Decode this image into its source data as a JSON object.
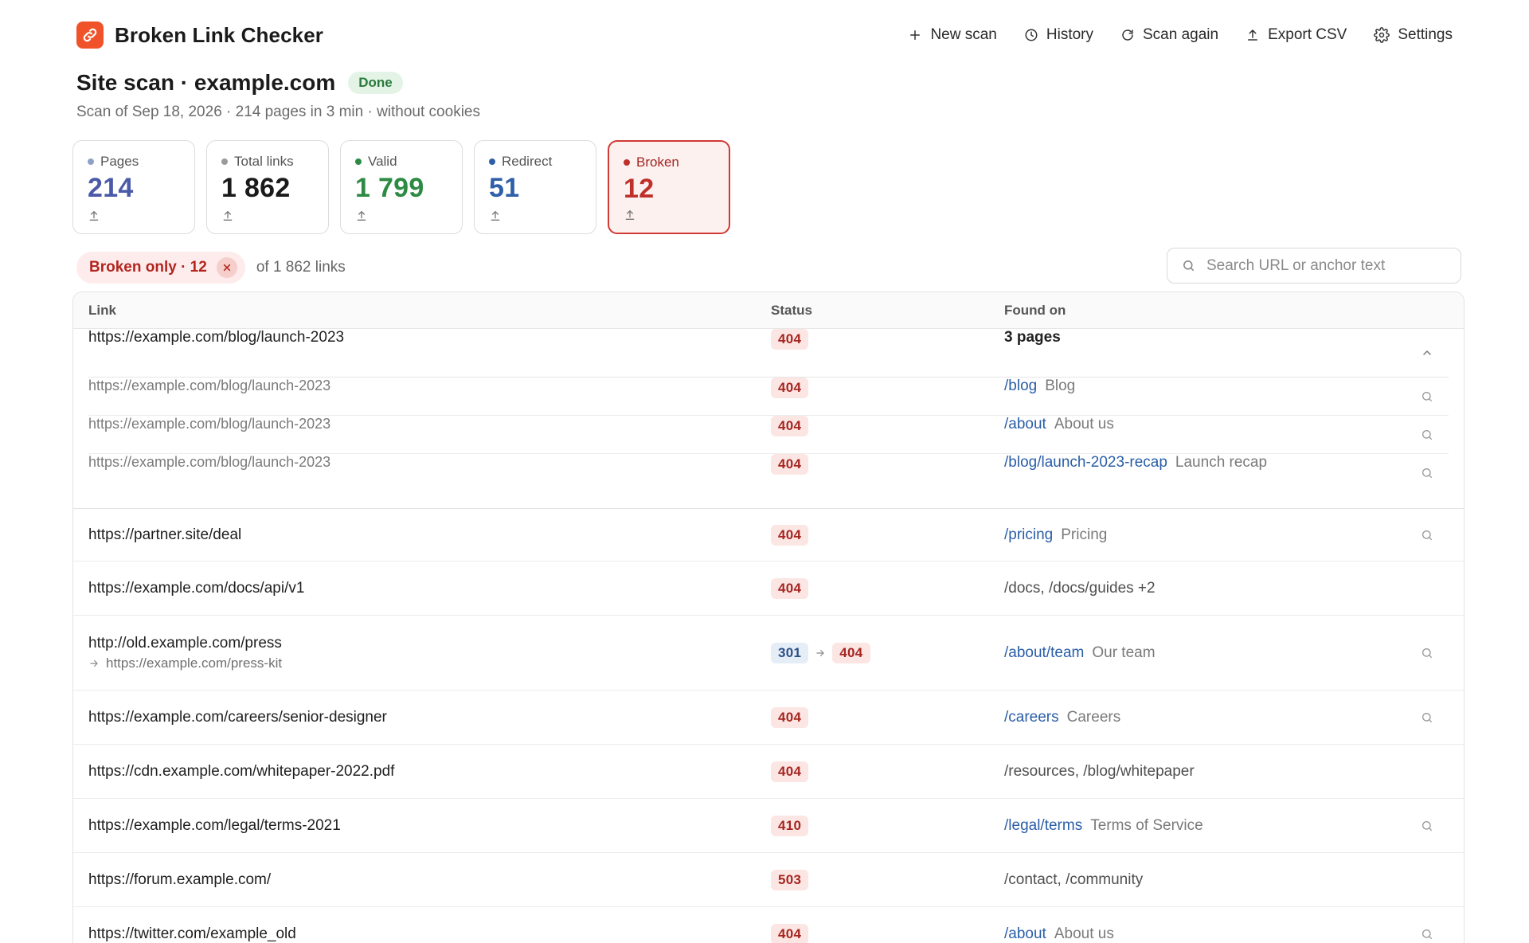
{
  "app": {
    "name": "Broken Link Checker",
    "accent": "#f0532a"
  },
  "nav": {
    "new_scan": "New scan",
    "history": "History",
    "scan_again": "Scan again",
    "export_csv": "Export CSV",
    "settings": "Settings"
  },
  "scan": {
    "title": "Site scan · example.com",
    "status": "Done",
    "subtitle": "Scan of Sep 18, 2026 · 214 pages in 3 min · without cookies"
  },
  "stats": [
    {
      "label": "Pages",
      "value": "214",
      "color": "#4a5aa8",
      "dot": "#8fa0c8"
    },
    {
      "label": "Total links",
      "value": "1 862",
      "color": "#1a1a1a",
      "dot": "#9a9a9a"
    },
    {
      "label": "Valid",
      "value": "1 799",
      "color": "#2d8a43",
      "dot": "#2d8a43"
    },
    {
      "label": "Redirect",
      "value": "51",
      "color": "#2f5fa8",
      "dot": "#2f5fa8"
    },
    {
      "label": "Broken",
      "value": "12",
      "color": "#c0302a",
      "dot": "#c0302a"
    }
  ],
  "filter": {
    "chip_label": "Broken only · 12",
    "count_text": "of 1 862 links",
    "search_placeholder": "Search URL or anchor text"
  },
  "table": {
    "headers": {
      "link": "Link",
      "status": "Status",
      "found_on": "Found on"
    },
    "expanded": {
      "url": "https://example.com/blog/launch-2023",
      "status": "404",
      "found_summary": "3 pages",
      "subrows": [
        {
          "url": "https://example.com/blog/launch-2023",
          "status": "404",
          "path": "/blog",
          "title": "Blog"
        },
        {
          "url": "https://example.com/blog/launch-2023",
          "status": "404",
          "path": "/about",
          "title": "About us"
        },
        {
          "url": "https://example.com/blog/launch-2023",
          "status": "404",
          "path": "/blog/launch-2023-recap",
          "title": "Launch recap"
        }
      ]
    },
    "rows": [
      {
        "url": "https://partner.site/deal",
        "status": "404",
        "path": "/pricing",
        "title": "Pricing"
      },
      {
        "url": "https://example.com/docs/api/v1",
        "status": "404",
        "plain": "/docs, /docs/guides +2"
      },
      {
        "url": "http://old.example.com/press",
        "redirect_to": "https://example.com/press-kit",
        "redirect_status": "301",
        "status": "404",
        "path": "/about/team",
        "title": "Our team"
      },
      {
        "url": "https://example.com/careers/senior-designer",
        "status": "404",
        "path": "/careers",
        "title": "Careers"
      },
      {
        "url": "https://cdn.example.com/whitepaper-2022.pdf",
        "status": "404",
        "plain": "/resources, /blog/whitepaper"
      },
      {
        "url": "https://example.com/legal/terms-2021",
        "status": "410",
        "path": "/legal/terms",
        "title": "Terms of Service"
      },
      {
        "url": "https://forum.example.com/",
        "status": "503",
        "plain": "/contact, /community"
      },
      {
        "url": "https://twitter.com/example_old",
        "status": "404",
        "path": "/about",
        "title": "About us"
      }
    ]
  }
}
